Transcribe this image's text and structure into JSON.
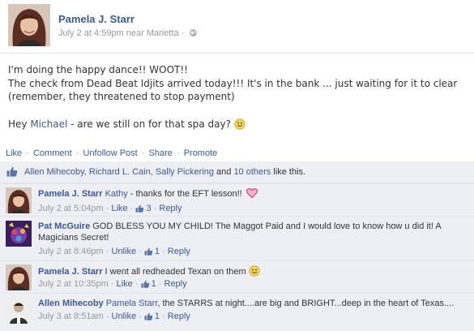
{
  "post": {
    "author": "Pamela J. Starr",
    "meta": "July 2 at 4:59pm near Marietta",
    "meta_sep": "·",
    "line1": "I'm doing the happy dance!! WOOT!!",
    "line2": "The check from Dead Beat Idjits arrived today!!! It's in the bank ... just waiting for it to clear",
    "line3": "(remember, they threatened to stop payment)",
    "line4_pre": "Hey ",
    "line4_link": "Michael",
    "line4_post": " - are we still on for that spa day? "
  },
  "actions": {
    "like": "Like",
    "comment": "Comment",
    "unfollow": "Unfollow Post",
    "share": "Share",
    "promote": "Promote",
    "sep": "·"
  },
  "likes": {
    "names": "Allen Mihecoby, Richard L. Cain, Sally Pickering",
    "and": " and ",
    "others": "10 others",
    "suffix": " like this."
  },
  "comments": [
    {
      "name": "Pamela J. Starr",
      "mention": "Kathy",
      "text": " - thanks for the EFT lesson!! ",
      "time": "July 2 at 5:04pm",
      "action": "Like",
      "likes": "3",
      "reply": "Reply"
    },
    {
      "name": "Pat McGuire",
      "text": " GOD BLESS YOU MY CHILD! The Maggot Paid and I would love to know how u did it! A Magicians Secret!",
      "time": "July 2 at 8:46pm",
      "action": "Unlike",
      "likes": "1",
      "reply": "Reply"
    },
    {
      "name": "Pamela J. Starr",
      "text": " I went all redheaded Texan on them ",
      "time": "July 2 at 10:35pm",
      "action": "Like",
      "likes": "1",
      "reply": "Reply"
    },
    {
      "name": "Allen Mihecoby",
      "mention": "Pamela Starr",
      "text": ", the STARRS at night....are big and BRIGHT...deep in the heart of Texas....",
      "time": "July 3 at 8:51am",
      "action": "Unlike",
      "likes": "1",
      "reply": "Reply"
    }
  ],
  "colors": {
    "link": "#3b5998",
    "meta": "#999999",
    "feedback_bg": "#edeff4",
    "heart": "#e0245e"
  },
  "icons": [
    "globe-icon",
    "smiley-icon",
    "thumbs-up-icon",
    "heart-icon"
  ]
}
